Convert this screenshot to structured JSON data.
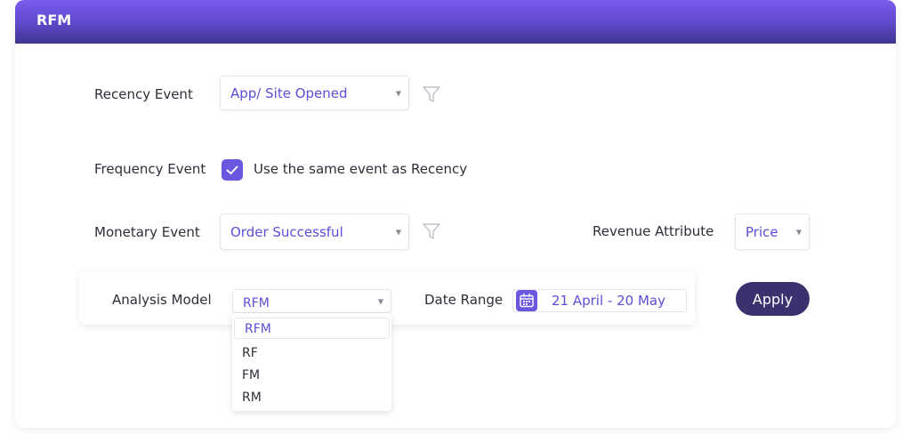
{
  "header": {
    "title": "RFM"
  },
  "recency": {
    "label": "Recency Event",
    "selected": "App/ Site Opened"
  },
  "frequency": {
    "label": "Frequency Event",
    "checked": true,
    "checkbox_label": "Use the same event as Recency"
  },
  "monetary": {
    "label": "Monetary Event",
    "selected": "Order Successful"
  },
  "revenue": {
    "label": "Revenue Attribute",
    "selected": "Price"
  },
  "analysis": {
    "label": "Analysis Model",
    "selected": "RFM",
    "options": [
      "RFM",
      "RF",
      "FM",
      "RM"
    ]
  },
  "date_range": {
    "label": "Date Range",
    "value": "21 April - 20 May"
  },
  "apply_label": "Apply",
  "icons": {
    "filter": "filter-icon",
    "check": "check-icon",
    "calendar": "calendar-icon",
    "caret": "caret-down-icon"
  },
  "colors": {
    "accent": "#6a57e0",
    "header_top": "#7b5cf0",
    "header_bottom": "#3e3592",
    "apply_button": "#3a316e",
    "value_text": "#5a4fd8"
  }
}
